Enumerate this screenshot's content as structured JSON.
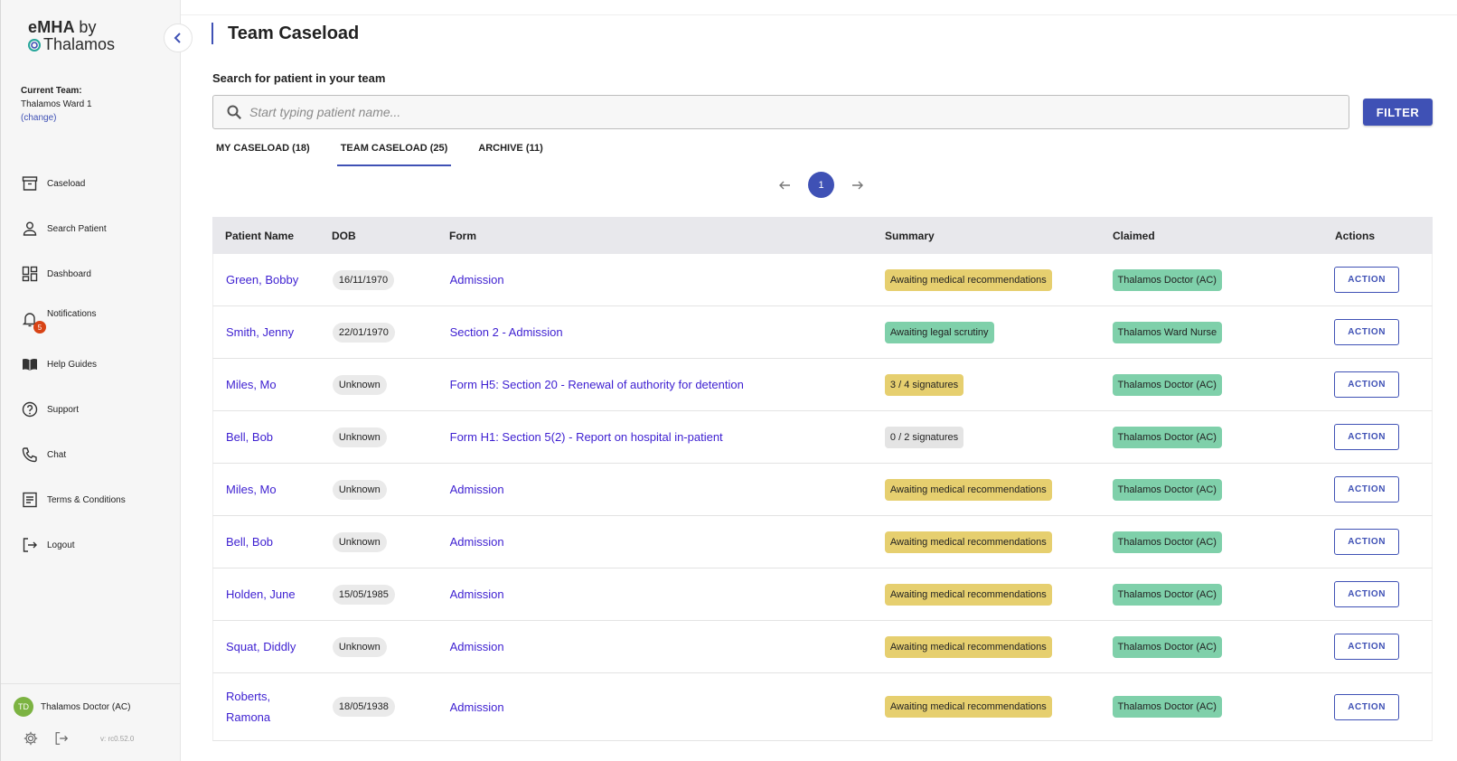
{
  "app": {
    "logo_line1": "eMHA",
    "logo_by": "by",
    "logo_line2": "Thalamos"
  },
  "sidebar": {
    "current_team_label": "Current Team:",
    "current_team_name": "Thalamos Ward 1",
    "change_link": "(change)",
    "items": [
      {
        "label": "Caseload",
        "icon": "archive-box-icon"
      },
      {
        "label": "Search Patient",
        "icon": "person-icon"
      },
      {
        "label": "Dashboard",
        "icon": "dashboard-icon"
      },
      {
        "label": "Notifications",
        "icon": "bell-icon",
        "badge": "5"
      },
      {
        "label": "Help Guides",
        "icon": "book-icon"
      },
      {
        "label": "Support",
        "icon": "help-circle-icon"
      },
      {
        "label": "Chat",
        "icon": "phone-icon"
      },
      {
        "label": "Terms & Conditions",
        "icon": "document-icon"
      },
      {
        "label": "Logout",
        "icon": "logout-icon"
      }
    ],
    "user": {
      "initials": "TD",
      "name": "Thalamos Doctor (AC)"
    },
    "version": "v: rc0.52.0"
  },
  "main": {
    "title": "Team Caseload",
    "search_label": "Search for patient in your team",
    "search_placeholder": "Start typing patient name...",
    "filter_label": "FILTER",
    "tabs": [
      {
        "label": "MY CASELOAD (18)",
        "active": false
      },
      {
        "label": "TEAM CASELOAD (25)",
        "active": true
      },
      {
        "label": "ARCHIVE (11)",
        "active": false
      }
    ],
    "current_page": "1",
    "columns": [
      "Patient Name",
      "DOB",
      "Form",
      "Summary",
      "Claimed",
      "Actions"
    ],
    "action_label": "ACTION",
    "rows": [
      {
        "name": "Green, Bobby",
        "dob": "16/11/1970",
        "form": "Admission",
        "summary": "Awaiting medical recommendations",
        "summary_color": "yellow",
        "claimed": "Thalamos Doctor (AC)"
      },
      {
        "name": "Smith, Jenny",
        "dob": "22/01/1970",
        "form": "Section 2 - Admission",
        "summary": "Awaiting legal scrutiny",
        "summary_color": "green",
        "claimed": "Thalamos Ward Nurse"
      },
      {
        "name": "Miles, Mo",
        "dob": "Unknown",
        "form": "Form H5: Section 20 - Renewal of authority for detention",
        "summary": "3 / 4 signatures",
        "summary_color": "yellow",
        "claimed": "Thalamos Doctor (AC)"
      },
      {
        "name": "Bell, Bob",
        "dob": "Unknown",
        "form": "Form H1: Section 5(2) - Report on hospital in-patient",
        "summary": "0 / 2 signatures",
        "summary_color": "grey",
        "claimed": "Thalamos Doctor (AC)"
      },
      {
        "name": "Miles, Mo",
        "dob": "Unknown",
        "form": "Admission",
        "summary": "Awaiting medical recommendations",
        "summary_color": "yellow",
        "claimed": "Thalamos Doctor (AC)"
      },
      {
        "name": "Bell, Bob",
        "dob": "Unknown",
        "form": "Admission",
        "summary": "Awaiting medical recommendations",
        "summary_color": "yellow",
        "claimed": "Thalamos Doctor (AC)"
      },
      {
        "name": "Holden, June",
        "dob": "15/05/1985",
        "form": "Admission",
        "summary": "Awaiting medical recommendations",
        "summary_color": "yellow",
        "claimed": "Thalamos Doctor (AC)"
      },
      {
        "name": "Squat, Diddly",
        "dob": "Unknown",
        "form": "Admission",
        "summary": "Awaiting medical recommendations",
        "summary_color": "yellow",
        "claimed": "Thalamos Doctor (AC)"
      },
      {
        "name": "Roberts, Ramona",
        "dob": "18/05/1938",
        "form": "Admission",
        "summary": "Awaiting medical recommendations",
        "summary_color": "yellow",
        "claimed": "Thalamos Doctor (AC)"
      }
    ]
  },
  "colors": {
    "accent": "#3f51b5",
    "link": "#3d1fd1",
    "chip_yellow": "#e6cf6f",
    "chip_green": "#7fd0aa",
    "badge": "#d84315",
    "avatar": "#7cb342"
  }
}
